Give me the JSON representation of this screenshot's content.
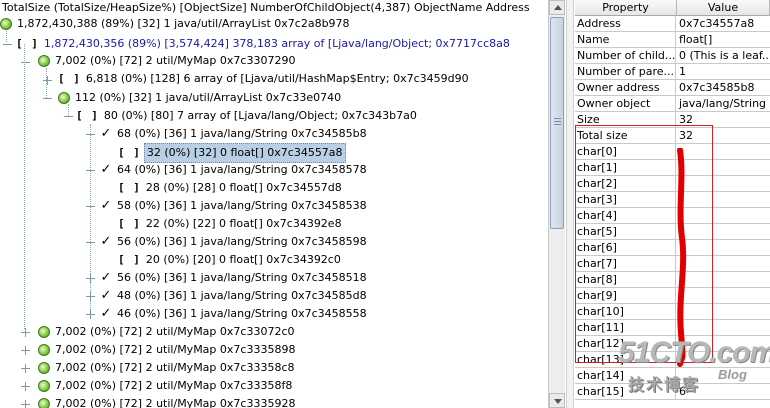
{
  "tree": {
    "header": "TotalSize (TotalSize/HeapSize%) [ObjectSize] NumberOfChildObject(4,387) ObjectName Address",
    "nodes": [
      {
        "text": "1,872,430,388 (89%) [32] 1 java/util/ArrayList 0x7c2a8b978",
        "icon": "object-icon"
      },
      {
        "text": "1,872,430,356 (89%) [3,574,424] 378,183 array of [Ljava/lang/Object; 0x7717cc8a8",
        "icon": "array-icon"
      },
      {
        "text": "7,002 (0%) [72] 2 util/MyMap 0x7c3307290",
        "icon": "object-icon"
      },
      {
        "text": "6,818 (0%) [128] 6 array of [Ljava/util/HashMap$Entry; 0x7c3459d90",
        "icon": "array-icon"
      },
      {
        "text": "112 (0%) [32] 1 java/util/ArrayList 0x7c33e0740",
        "icon": "object-icon"
      },
      {
        "text": "80 (0%) [80] 7 array of [Ljava/lang/Object; 0x7c343b7a0",
        "icon": "array-icon"
      },
      {
        "text": "68 (0%) [36] 1 java/lang/String 0x7c34585b8",
        "icon": "check-icon"
      },
      {
        "text": "32 (0%) [32] 0 float[] 0x7c34557a8",
        "icon": "array-icon"
      },
      {
        "text": "64 (0%) [36] 1 java/lang/String 0x7c3458578",
        "icon": "check-icon"
      },
      {
        "text": "28 (0%) [28] 0 float[] 0x7c34557d8",
        "icon": "array-icon"
      },
      {
        "text": "58 (0%) [36] 1 java/lang/String 0x7c3458538",
        "icon": "check-icon"
      },
      {
        "text": "22 (0%) [22] 0 float[] 0x7c34392e8",
        "icon": "array-icon"
      },
      {
        "text": "56 (0%) [36] 1 java/lang/String 0x7c3458598",
        "icon": "check-icon"
      },
      {
        "text": "20 (0%) [20] 0 float[] 0x7c34392c0",
        "icon": "array-icon"
      },
      {
        "text": "56 (0%) [36] 1 java/lang/String 0x7c3458518",
        "icon": "check-icon"
      },
      {
        "text": "48 (0%) [36] 1 java/lang/String 0x7c34585d8",
        "icon": "check-icon"
      },
      {
        "text": "46 (0%) [36] 1 java/lang/String 0x7c3458558",
        "icon": "check-icon"
      },
      {
        "text": "7,002 (0%) [72] 2 util/MyMap 0x7c33072c0",
        "icon": "object-icon"
      },
      {
        "text": "7,002 (0%) [72] 2 util/MyMap 0x7c3335898",
        "icon": "object-icon"
      },
      {
        "text": "7,002 (0%) [72] 2 util/MyMap 0x7c33358c8",
        "icon": "object-icon"
      },
      {
        "text": "7,002 (0%) [72] 2 util/MyMap 0x7c33358f8",
        "icon": "object-icon"
      },
      {
        "text": "7,002 (0%) [72] 2 util/MyMap 0x7c3335928",
        "icon": "object-icon"
      }
    ]
  },
  "properties": {
    "column_property": "Property",
    "column_value": "Value",
    "rows": [
      {
        "key": "Address",
        "value": "0x7c34557a8"
      },
      {
        "key": "Name",
        "value": "float[]"
      },
      {
        "key": "Number of child...",
        "value": "0 (This is a leaf..."
      },
      {
        "key": "Number of pare...",
        "value": "1"
      },
      {
        "key": "Owner address",
        "value": "0x7c34585b8"
      },
      {
        "key": "Owner object",
        "value": "java/lang/String"
      },
      {
        "key": "Size",
        "value": "32"
      },
      {
        "key": "Total size",
        "value": "32"
      },
      {
        "key": "char[0]",
        "value": ""
      },
      {
        "key": "char[1]",
        "value": ""
      },
      {
        "key": "char[2]",
        "value": ""
      },
      {
        "key": "char[3]",
        "value": ""
      },
      {
        "key": "char[4]",
        "value": ""
      },
      {
        "key": "char[5]",
        "value": ""
      },
      {
        "key": "char[6]",
        "value": ""
      },
      {
        "key": "char[7]",
        "value": ""
      },
      {
        "key": "char[8]",
        "value": ""
      },
      {
        "key": "char[9]",
        "value": ""
      },
      {
        "key": "char[10]",
        "value": ""
      },
      {
        "key": "char[11]",
        "value": ""
      },
      {
        "key": "char[12]",
        "value": ""
      },
      {
        "key": "char[13]",
        "value": ""
      },
      {
        "key": "char[14]",
        "value": ""
      },
      {
        "key": "char[15]",
        "value": "6"
      }
    ]
  },
  "watermark": {
    "site": "51CTO.com",
    "tagline": "技术博客",
    "blog": "Blog"
  },
  "colors": {
    "selection": "#b8cfe5",
    "link_blue": "#1a1aa6",
    "annotation_red": "#e00000"
  }
}
